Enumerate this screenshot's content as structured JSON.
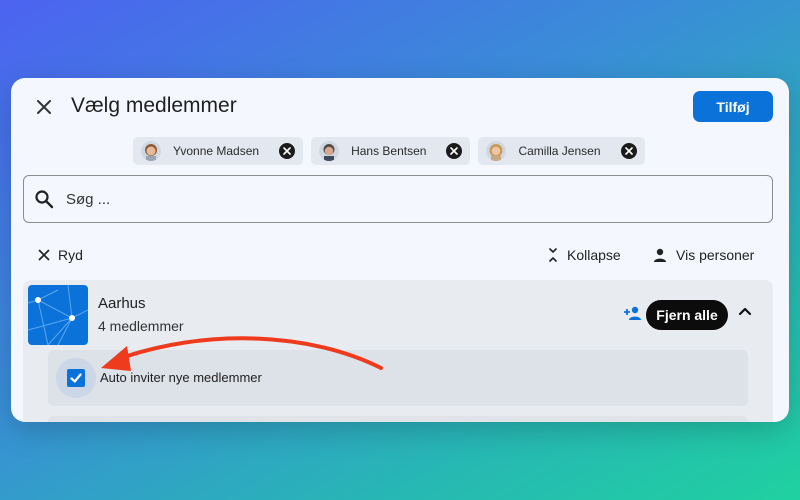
{
  "dialog": {
    "title": "Vælg medlemmer",
    "add_label": "Tilføj"
  },
  "selected": [
    {
      "name": "Yvonne Madsen",
      "skin": "#e7b89a",
      "hair": "#8a5a34"
    },
    {
      "name": "Hans Bentsen",
      "skin": "#d8a88d",
      "hair": "#4e4a48"
    },
    {
      "name": "Camilla Jensen",
      "skin": "#efc4a5",
      "hair": "#c59b55"
    }
  ],
  "search": {
    "placeholder": "Søg ..."
  },
  "toolbar": {
    "clear_label": "Ryd",
    "collapse_label": "Kollapse",
    "show_people_label": "Vis personer"
  },
  "group": {
    "name": "Aarhus",
    "count": "4 medlemmer",
    "remove_all_label": "Fjern alle",
    "icon_color": "#0b72d9"
  },
  "auto_invite": {
    "label": "Auto inviter nye medlemmer",
    "checked": true
  },
  "annotation": {
    "arrow_color": "#ee3a1d"
  }
}
